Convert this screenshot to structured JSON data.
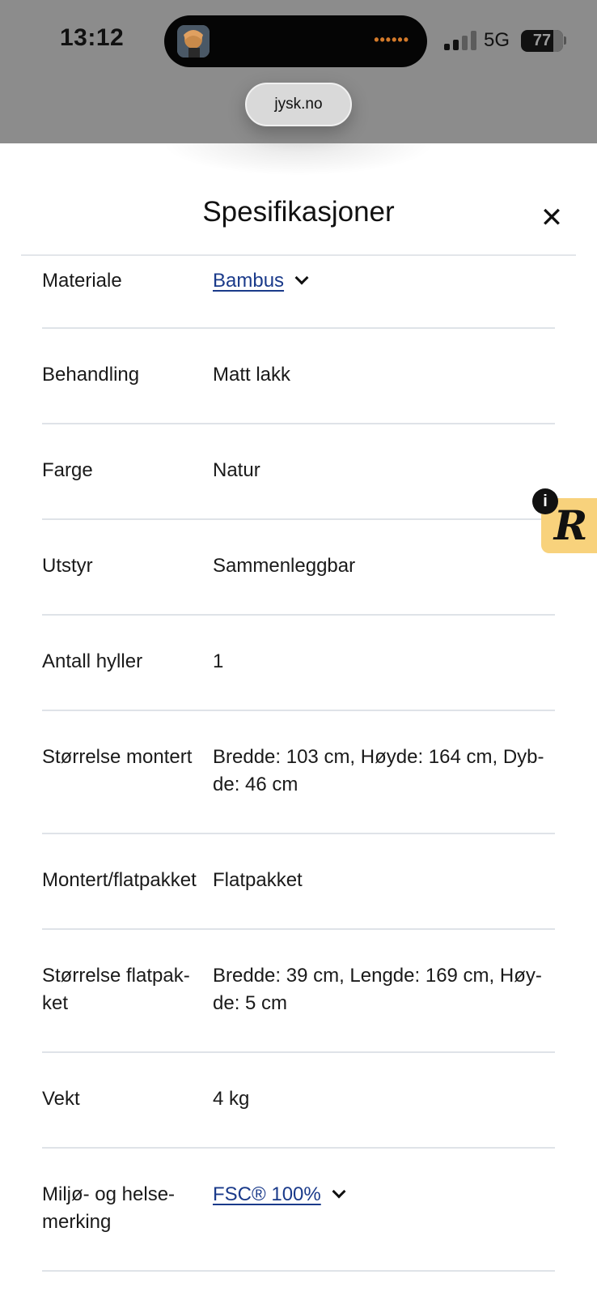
{
  "status_bar": {
    "time": "13:12",
    "network": "5G",
    "battery": "77"
  },
  "browser": {
    "url": "jysk.no"
  },
  "sheet": {
    "title": "Spesifikasjoner",
    "close_icon": "close-icon"
  },
  "specs": [
    {
      "label": "Materiale",
      "value": "Bambus",
      "link": true,
      "expandable": true
    },
    {
      "label": "Behandling",
      "value": "Matt lakk"
    },
    {
      "label": "Farge",
      "value": "Natur"
    },
    {
      "label": "Utstyr",
      "value": "Sammenleggbar"
    },
    {
      "label": "Antall hyller",
      "value": "1"
    },
    {
      "label": "Størrelse montert",
      "value_lines": [
        "Bredde: 103 cm, Høyde: 164 cm, Dyb-",
        "de: 46 cm"
      ]
    },
    {
      "label": "Montert/flatpakket",
      "value": "Flatpakket"
    },
    {
      "label_lines": [
        "Størrelse flatpak-",
        "ket"
      ],
      "value_lines": [
        "Bredde: 39 cm, Lengde: 169 cm, Høy-",
        "de: 5 cm"
      ]
    },
    {
      "label": "Vekt",
      "value": "4 kg"
    },
    {
      "label_lines": [
        "Miljø- og helse-",
        "merking"
      ],
      "value": "FSC® 100%",
      "link": true,
      "expandable": true
    }
  ],
  "badge": {
    "info_glyph": "i",
    "logo_glyph": "R"
  },
  "colors": {
    "link": "#1a3a8a",
    "badge": "#f8d27c",
    "divider": "#dfe3e8"
  }
}
